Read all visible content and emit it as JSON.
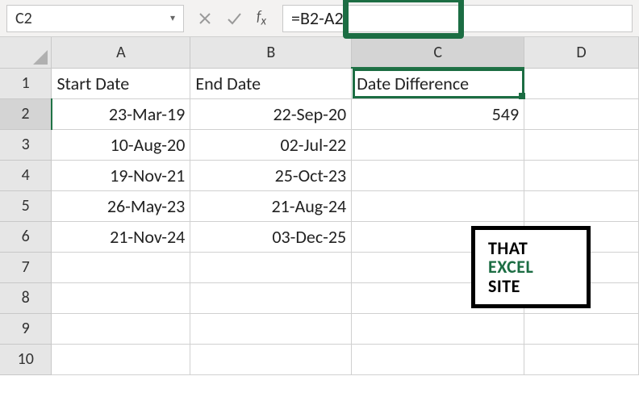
{
  "name_box": "C2",
  "formula": "=B2-A2",
  "col_headers": [
    "A",
    "B",
    "C",
    "D"
  ],
  "row_headers": [
    "1",
    "2",
    "3",
    "4",
    "5",
    "6",
    "7",
    "8",
    "9",
    "10"
  ],
  "data_headers": {
    "a": "Start Date",
    "b": "End Date",
    "c": "Date Difference"
  },
  "rows": [
    {
      "a": "23-Mar-19",
      "b": "22-Sep-20",
      "c": "549"
    },
    {
      "a": "10-Aug-20",
      "b": "02-Jul-22",
      "c": ""
    },
    {
      "a": "19-Nov-21",
      "b": "25-Oct-23",
      "c": ""
    },
    {
      "a": "26-May-23",
      "b": "21-Aug-24",
      "c": ""
    },
    {
      "a": "21-Nov-24",
      "b": "03-Dec-25",
      "c": ""
    }
  ],
  "active_cell": "C2",
  "logo": {
    "l1": "THAT",
    "l2": "EXCEL",
    "l3": "SITE"
  }
}
